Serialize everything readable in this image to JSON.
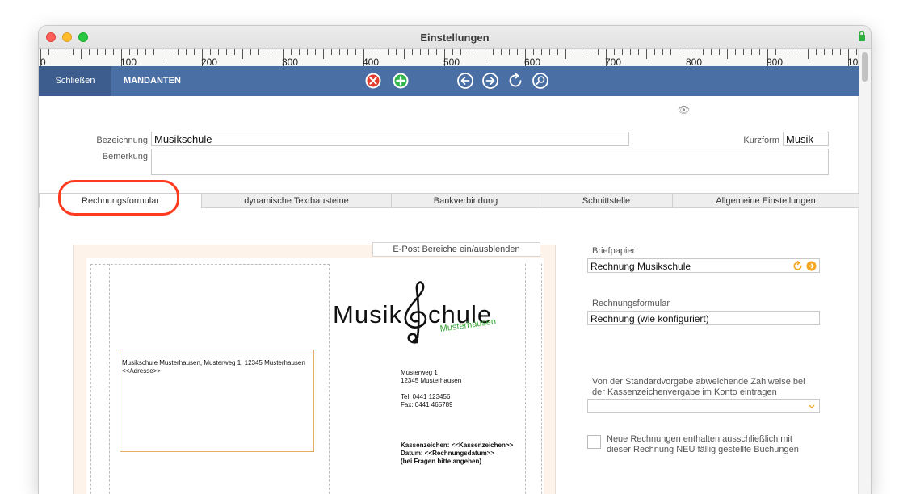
{
  "window": {
    "title": "Einstellungen"
  },
  "ruler": {
    "labels": [
      "0",
      "100",
      "200",
      "300",
      "400",
      "500",
      "600",
      "700",
      "800",
      "900",
      "10"
    ]
  },
  "toolbar": {
    "close_label": "Schließen",
    "section_label": "MANDANTEN",
    "icons": [
      "delete-icon",
      "add-icon",
      "arrow-left-icon",
      "arrow-right-icon",
      "refresh-icon",
      "search-icon"
    ]
  },
  "form": {
    "bezeichnung_label": "Bezeichnung",
    "bezeichnung_value": "Musikschule",
    "kurzform_label": "Kurzform",
    "kurzform_value": "Musik",
    "bemerkung_label": "Bemerkung",
    "bemerkung_value": ""
  },
  "tabs": [
    {
      "label": "Rechnungsformular",
      "active": true
    },
    {
      "label": "dynamische Textbausteine"
    },
    {
      "label": "Bankverbindung"
    },
    {
      "label": "Schnittstelle"
    },
    {
      "label": "Allgemeine Einstellungen"
    }
  ],
  "preview": {
    "epost_button": "E-Post Bereiche ein/ausblenden",
    "logo_text_left": "Musik",
    "logo_text_right": "chule",
    "logo_subtext": "Musterhausen",
    "sender_line": "Musikschule Musterhausen, Musterweg 1, 12345 Musterhausen",
    "address_placeholder": "<<Adresse>>",
    "street": "Musterweg 1",
    "city": "12345 Musterhausen",
    "tel": "Tel:  0441 123456",
    "fax": "Fax: 0441 465789",
    "kassenzeichen": "Kassenzeichen: <<Kassenzeichen>>",
    "datum": "Datum: <<Rechnungsdatum>>",
    "fragen": "(bei Fragen bitte angeben)"
  },
  "settings": {
    "briefpapier_label": "Briefpapier",
    "briefpapier_value": "Rechnung Musikschule",
    "rechnungsformular_label": "Rechnungsformular",
    "rechnungsformular_value": "Rechnung (wie konfiguriert)",
    "zahlweise_line1": "Von der Standardvorgabe abweichende Zahlweise bei",
    "zahlweise_line2": "der Kassenzeichenvergabe im Konto eintragen",
    "zahlweise_value": "",
    "neue_line1": "Neue Rechnungen enthalten ausschließlich mit",
    "neue_line2": "dieser Rechnung NEU fällig gestellte Buchungen"
  },
  "colors": {
    "toolbar": "#4a6fa5",
    "toolbar_active": "#3c5d8e",
    "highlight": "#ff3b1f",
    "accent_orange": "#f5a623",
    "logo_green": "#3aa53a"
  }
}
